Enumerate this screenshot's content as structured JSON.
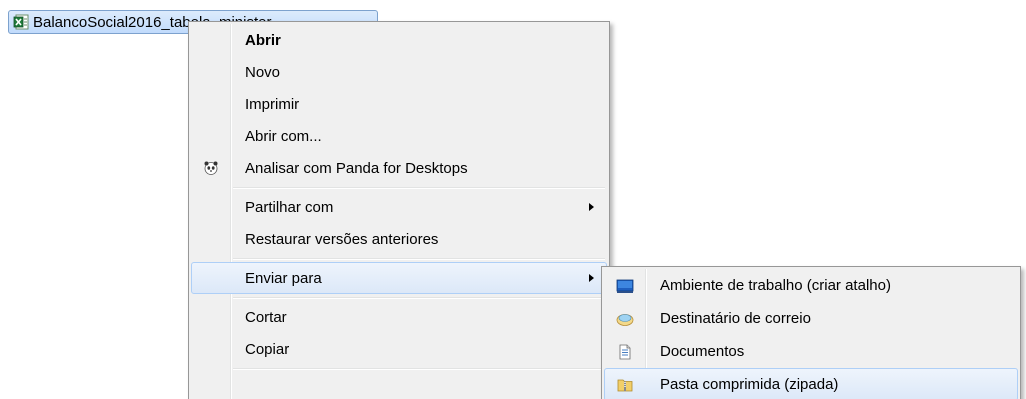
{
  "file": {
    "name": "BalancoSocial2016_tabela_minister",
    "icon": "excel-file-icon"
  },
  "context_menu": {
    "items": [
      {
        "label": "Abrir",
        "bold": true
      },
      {
        "label": "Novo"
      },
      {
        "label": "Imprimir"
      },
      {
        "label": "Abrir com..."
      },
      {
        "label": "Analisar com Panda for Desktops",
        "icon": "panda-icon"
      },
      {
        "label": "Partilhar com",
        "submenu": true
      },
      {
        "label": "Restaurar versões anteriores"
      },
      {
        "label": "Enviar para",
        "submenu": true,
        "highlighted": true
      },
      {
        "label": "Cortar"
      },
      {
        "label": "Copiar"
      }
    ]
  },
  "send_to_menu": {
    "items": [
      {
        "label": "Ambiente de trabalho (criar atalho)",
        "icon": "desktop-icon"
      },
      {
        "label": "Destinatário de correio",
        "icon": "mail-recipient-icon"
      },
      {
        "label": "Documentos",
        "icon": "documents-icon"
      },
      {
        "label": "Pasta comprimida (zipada)",
        "icon": "zip-folder-icon",
        "highlighted": true
      }
    ]
  },
  "colors": {
    "menu_bg": "#f0f0f0",
    "highlight_border": "#aecff7",
    "selection_bg": "#c1dbfc"
  }
}
